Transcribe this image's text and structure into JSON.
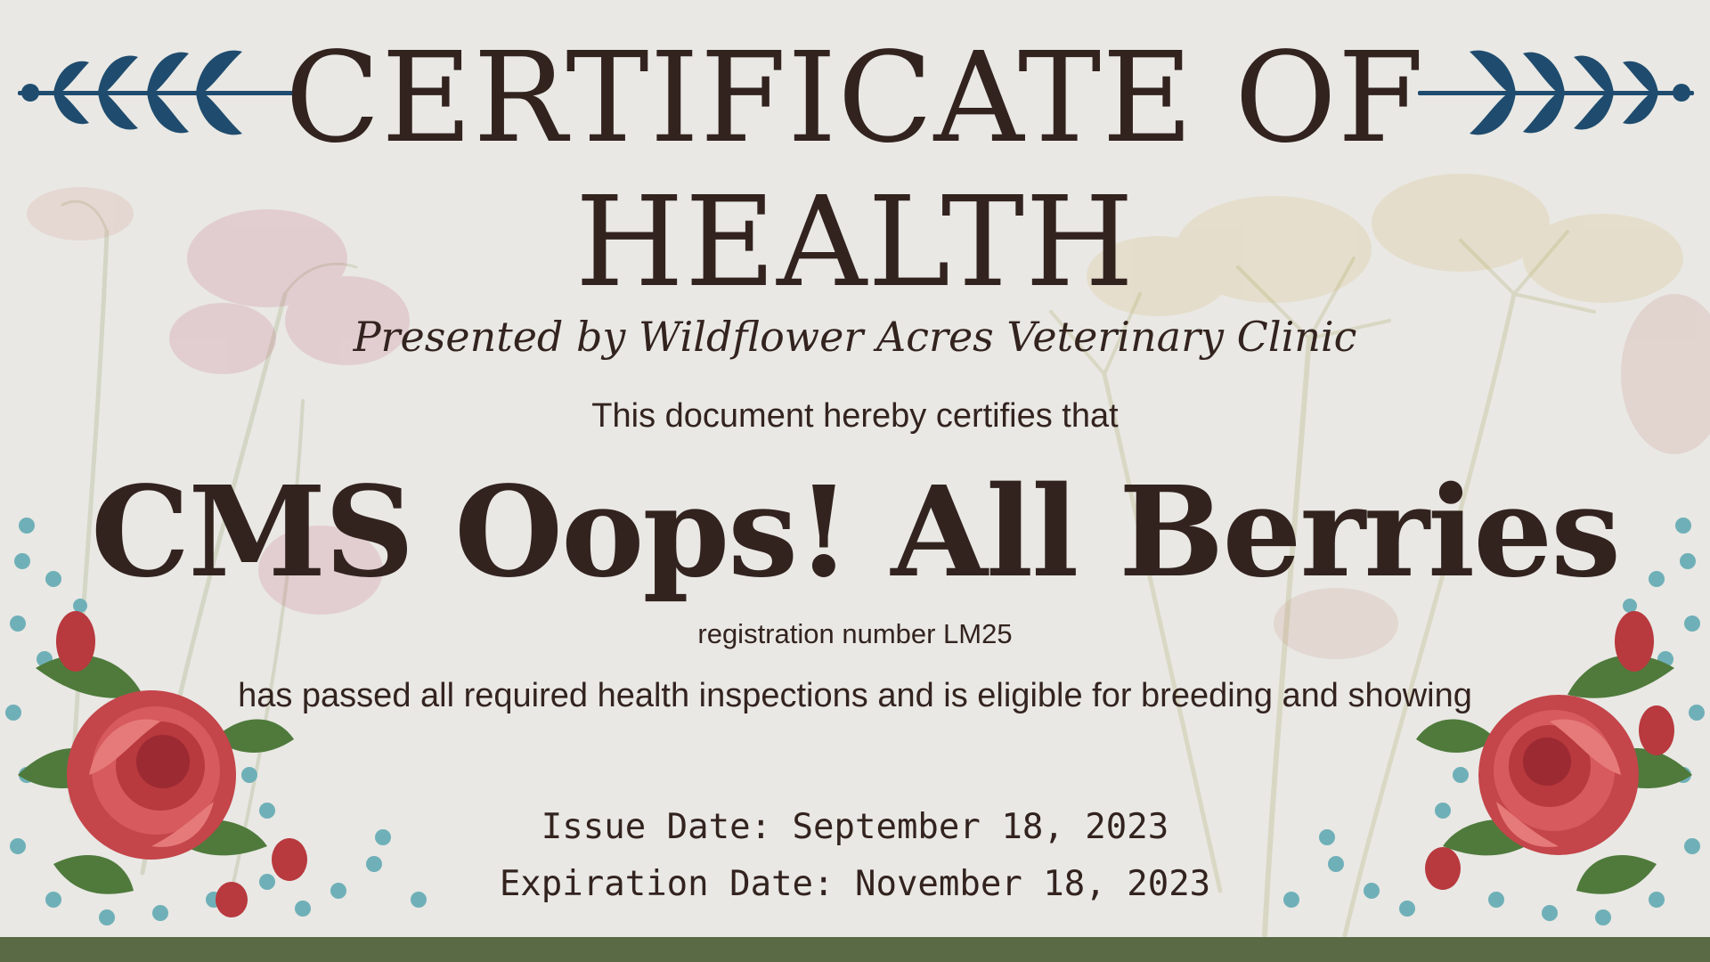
{
  "certificate": {
    "title_line_1": "CERTIFICATE OF",
    "title_line_2": "HEALTH",
    "presenter": "Presented by Wildflower Acres Veterinary Clinic",
    "lead": "This document hereby certifies that",
    "animal_name": "CMS Oops! All Berries",
    "registration": "registration number LM25",
    "statement": "has passed all required health inspections and is eligible for breeding and showing",
    "issue_date": "Issue Date: September 18, 2023",
    "expiration_date": "Expiration Date: November 18, 2023"
  },
  "decorations": {
    "title_ornament": "laurel-branch-icon",
    "corner_ornament": "rose-bouquet",
    "background": "pressed-wildflowers"
  },
  "colors": {
    "paper": "#e9e8e4",
    "ink": "#33231f",
    "laurel": "#1f4c6e",
    "rose": "#c8484c",
    "footer": "#5a6a44"
  }
}
